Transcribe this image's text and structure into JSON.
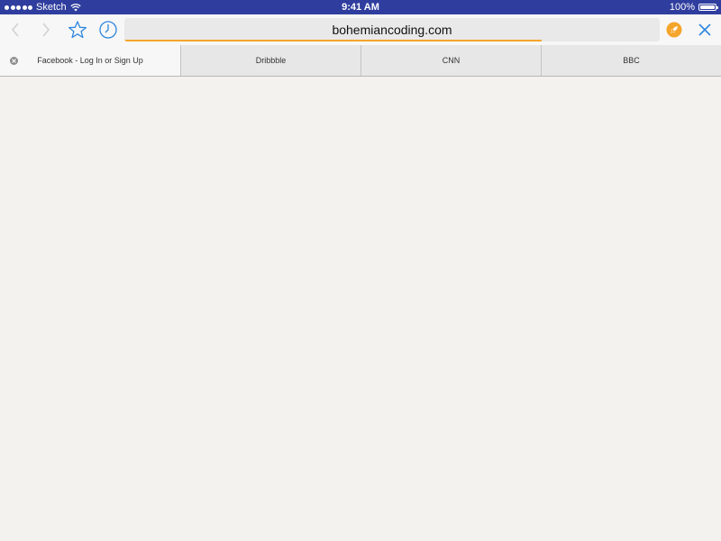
{
  "status_bar": {
    "carrier": "Sketch",
    "time": "9:41 AM",
    "battery_text": "100%",
    "battery_level": 1.0
  },
  "toolbar": {
    "url": "bohemiancoding.com",
    "load_progress": 0.78,
    "accent_color": "#2e86de",
    "rocket_color": "#f5a52a",
    "icons": [
      "back-icon",
      "forward-icon",
      "star-icon",
      "clock-icon",
      "rocket-icon",
      "close-icon"
    ]
  },
  "tabs": [
    {
      "label": "Facebook - Log In or Sign Up",
      "active": true
    },
    {
      "label": "Dribbble",
      "active": false
    },
    {
      "label": "CNN",
      "active": false
    },
    {
      "label": "BBC",
      "active": false
    }
  ]
}
